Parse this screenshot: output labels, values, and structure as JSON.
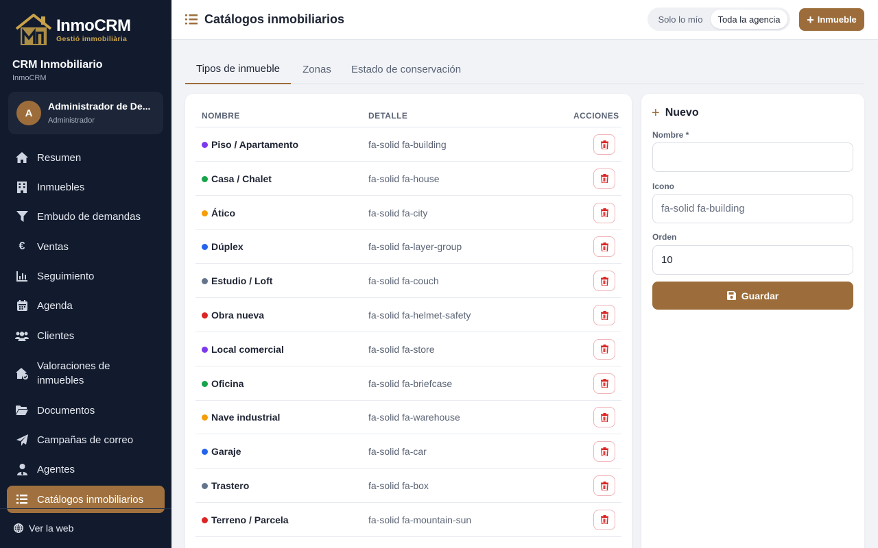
{
  "brand": {
    "name": "InmoCRM",
    "tagline": "Gestió immobiliària",
    "accent": "#9c6d3a",
    "gold": "#c9a24a",
    "sidebar_bg": "#121b2e"
  },
  "sidebar": {
    "crm_title": "CRM Inmobiliario",
    "crm_sub": "InmoCRM",
    "user": {
      "initial": "A",
      "name": "Administrador de De...",
      "role": "Administrador"
    },
    "items": [
      {
        "label": "Resumen",
        "icon": "home-icon"
      },
      {
        "label": "Inmuebles",
        "icon": "building-icon"
      },
      {
        "label": "Embudo de demandas",
        "icon": "filter-icon"
      },
      {
        "label": "Ventas",
        "icon": "euro-icon"
      },
      {
        "label": "Seguimiento",
        "icon": "chart-icon"
      },
      {
        "label": "Agenda",
        "icon": "calendar-icon"
      },
      {
        "label": "Clientes",
        "icon": "users-icon"
      },
      {
        "label": "Valoraciones de inmuebles",
        "icon": "house-check-icon"
      },
      {
        "label": "Documentos",
        "icon": "folder-icon"
      },
      {
        "label": "Campañas de correo",
        "icon": "paper-plane-icon"
      },
      {
        "label": "Agentes",
        "icon": "user-tie-icon"
      },
      {
        "label": "Catálogos inmobiliarios",
        "icon": "list-icon"
      }
    ],
    "footer_link": "Ver la web"
  },
  "header": {
    "title": "Catálogos inmobiliarios",
    "scope_mine": "Solo lo mío",
    "scope_agency": "Toda la agencia",
    "add_label": "Inmueble"
  },
  "tabs": [
    "Tipos de inmueble",
    "Zonas",
    "Estado de conservación"
  ],
  "table": {
    "columns": [
      "NOMBRE",
      "DETALLE",
      "ACCIONES"
    ],
    "rows": [
      {
        "name": "Piso / Apartamento",
        "detail": "fa-solid fa-building",
        "color": "#7c3aed"
      },
      {
        "name": "Casa / Chalet",
        "detail": "fa-solid fa-house",
        "color": "#16a34a"
      },
      {
        "name": "Ático",
        "detail": "fa-solid fa-city",
        "color": "#f59e0b"
      },
      {
        "name": "Dúplex",
        "detail": "fa-solid fa-layer-group",
        "color": "#2563eb"
      },
      {
        "name": "Estudio / Loft",
        "detail": "fa-solid fa-couch",
        "color": "#64748b"
      },
      {
        "name": "Obra nueva",
        "detail": "fa-solid fa-helmet-safety",
        "color": "#dc2626"
      },
      {
        "name": "Local comercial",
        "detail": "fa-solid fa-store",
        "color": "#7c3aed"
      },
      {
        "name": "Oficina",
        "detail": "fa-solid fa-briefcase",
        "color": "#16a34a"
      },
      {
        "name": "Nave industrial",
        "detail": "fa-solid fa-warehouse",
        "color": "#f59e0b"
      },
      {
        "name": "Garaje",
        "detail": "fa-solid fa-car",
        "color": "#2563eb"
      },
      {
        "name": "Trastero",
        "detail": "fa-solid fa-box",
        "color": "#64748b"
      },
      {
        "name": "Terreno / Parcela",
        "detail": "fa-solid fa-mountain-sun",
        "color": "#dc2626"
      }
    ]
  },
  "form": {
    "title": "Nuevo",
    "name_label": "Nombre *",
    "name_value": "",
    "icon_label": "Icono",
    "icon_placeholder": "fa-solid fa-building",
    "order_label": "Orden",
    "order_value": "10",
    "save_label": "Guardar"
  }
}
